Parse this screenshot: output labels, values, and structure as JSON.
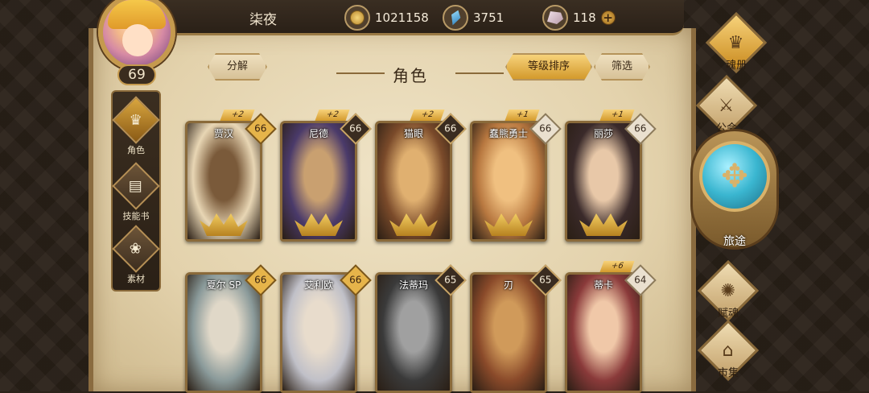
{
  "player": {
    "name": "柒夜",
    "level": "69"
  },
  "resources": {
    "gold": "1021158",
    "crystal": "3751",
    "stone": "118"
  },
  "header": {
    "decompose_label": "分解",
    "title": "角色",
    "sort_label": "等级排序",
    "filter_label": "筛选"
  },
  "sidebar": {
    "items": [
      {
        "label": "角色"
      },
      {
        "label": "技能书"
      },
      {
        "label": "素材"
      }
    ]
  },
  "cards": [
    {
      "name": "贾汉",
      "level": "66",
      "plus": "+2",
      "badge": "gold",
      "colors": [
        "#e8d6b4",
        "#7a5a3a"
      ]
    },
    {
      "name": "尼德",
      "level": "66",
      "plus": "+2",
      "badge": "dark",
      "colors": [
        "#4a3a6a",
        "#c9a070"
      ]
    },
    {
      "name": "猫眼",
      "level": "66",
      "plus": "+2",
      "badge": "dark",
      "colors": [
        "#7a4a2a",
        "#e0b070"
      ]
    },
    {
      "name": "蠢熊勇士",
      "level": "66",
      "plus": "+1",
      "badge": "light",
      "colors": [
        "#b87840",
        "#f0c080"
      ]
    },
    {
      "name": "丽莎",
      "level": "66",
      "plus": "+1",
      "badge": "light",
      "colors": [
        "#3a2a2a",
        "#e8c8a8"
      ]
    },
    {
      "name": "夏尔 SP",
      "level": "66",
      "plus": "",
      "badge": "gold",
      "colors": [
        "#8a9a9a",
        "#e0d8c8"
      ]
    },
    {
      "name": "艾利欧",
      "level": "66",
      "plus": "",
      "badge": "gold",
      "colors": [
        "#c0c0c8",
        "#e8dccc"
      ]
    },
    {
      "name": "法蒂玛",
      "level": "65",
      "plus": "",
      "badge": "dark",
      "colors": [
        "#3a3a3a",
        "#a0a0a0"
      ]
    },
    {
      "name": "刃",
      "level": "65",
      "plus": "",
      "badge": "dark",
      "colors": [
        "#8a4a2a",
        "#d09a5a"
      ]
    },
    {
      "name": "蒂卡",
      "level": "64",
      "plus": "+6",
      "badge": "light",
      "colors": [
        "#8a3a3a",
        "#f0c8a8"
      ]
    }
  ],
  "right_nav": [
    {
      "label": "魂册",
      "icon": "soul-book-icon",
      "glyph": "♛"
    },
    {
      "label": "公会",
      "icon": "guild-icon",
      "glyph": "⚔"
    },
    {
      "label": "旅途",
      "icon": "journey-icon",
      "glyph": "✥"
    },
    {
      "label": "赋魂",
      "icon": "soul-infuse-icon",
      "glyph": "✺"
    },
    {
      "label": "市集",
      "icon": "market-icon",
      "glyph": "⌂"
    }
  ]
}
